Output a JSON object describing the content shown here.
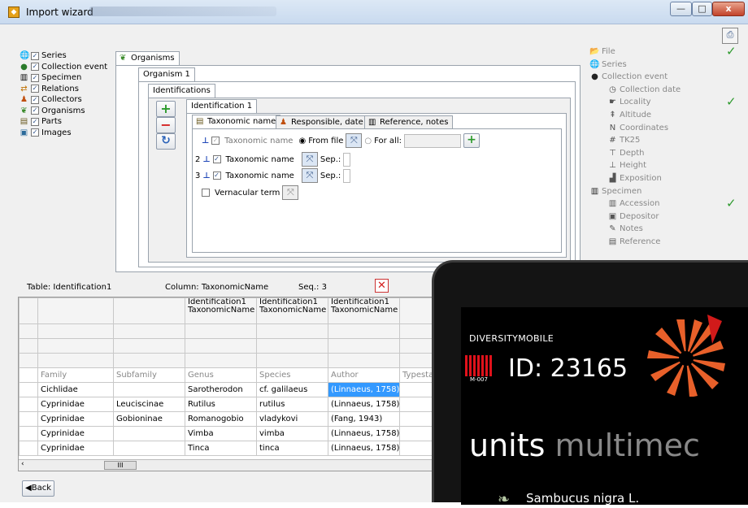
{
  "window": {
    "title": "Import wizard",
    "min": "—",
    "max": "□",
    "close": "x"
  },
  "tree": [
    {
      "label": "Series",
      "icon": "globe-icon",
      "glyph": "🌐",
      "color": "#1a5ab8"
    },
    {
      "label": "Collection event",
      "icon": "earth-icon",
      "glyph": "●",
      "color": "#2a7a2a"
    },
    {
      "label": "Specimen",
      "icon": "barcode-icon",
      "glyph": "▥",
      "color": "#000"
    },
    {
      "label": "Relations",
      "icon": "relations-icon",
      "glyph": "⇄",
      "color": "#c07000"
    },
    {
      "label": "Collectors",
      "icon": "people-icon",
      "glyph": "♟",
      "color": "#c05010"
    },
    {
      "label": "Organisms",
      "icon": "leaf-icon",
      "glyph": "❦",
      "color": "#3a8a2a"
    },
    {
      "label": "Parts",
      "icon": "parts-icon",
      "glyph": "▤",
      "color": "#6a5a20"
    },
    {
      "label": "Images",
      "icon": "image-icon",
      "glyph": "▣",
      "color": "#2a6a9a"
    }
  ],
  "tabs": {
    "organisms": "Organisms",
    "organism1": "Organism 1",
    "identifications": "Identifications",
    "identification1": "Identification 1",
    "taxonomic_name": "Taxonomic name",
    "responsible": "Responsible, date",
    "reference": "Reference, notes"
  },
  "form": {
    "row1_label": "Taxonomic name",
    "from_file": "From file",
    "for_all": "For all:",
    "row2_num": "2",
    "row2_label": "Taxonomic name",
    "sep": "Sep.:",
    "row3_num": "3",
    "row3_label": "Taxonomic name",
    "vernacular": "Vernacular term"
  },
  "status": {
    "table": "Table: Identification1",
    "column": "Column: TaxonomicName",
    "seq": "Seq.: 3"
  },
  "grid": {
    "top_headers": [
      "",
      "",
      "Identification1\nTaxonomicName",
      "Identification1\nTaxonomicName",
      "Identification1\nTaxonomicName",
      ""
    ],
    "col_headers": [
      "Family",
      "Subfamily",
      "Genus",
      "Species",
      "Author",
      "Typesta"
    ],
    "rows": [
      [
        "Cichlidae",
        "",
        "Sarotherodon",
        "cf. galilaeus",
        "(Linnaeus, 1758)",
        ""
      ],
      [
        "Cyprinidae",
        "Leuciscinae",
        "Rutilus",
        "rutilus",
        "(Linnaeus, 1758)",
        ""
      ],
      [
        "Cyprinidae",
        "Gobioninae",
        "Romanogobio",
        "vladykovi",
        "(Fang, 1943)",
        ""
      ],
      [
        "Cyprinidae",
        "",
        "Vimba",
        "vimba",
        "(Linnaeus, 1758)",
        ""
      ],
      [
        "Cyprinidae",
        "",
        "Tinca",
        "tinca",
        "(Linnaeus, 1758)",
        ""
      ]
    ],
    "scroll_thumb": "III"
  },
  "back": "◀Back",
  "right_tree": [
    {
      "label": "File",
      "glyph": "📂",
      "indent": 0,
      "check": true
    },
    {
      "label": "Series",
      "glyph": "🌐",
      "indent": 0,
      "check": false
    },
    {
      "label": "Collection event",
      "glyph": "●",
      "indent": 0,
      "check": false
    },
    {
      "label": "Collection date",
      "glyph": "◷",
      "indent": 1,
      "check": false
    },
    {
      "label": "Locality",
      "glyph": "☛",
      "indent": 1,
      "check": true
    },
    {
      "label": "Altitude",
      "glyph": "⇞",
      "indent": 1,
      "check": false
    },
    {
      "label": "Coordinates",
      "glyph": "N",
      "indent": 1,
      "check": false
    },
    {
      "label": "TK25",
      "glyph": "#",
      "indent": 1,
      "check": false
    },
    {
      "label": "Depth",
      "glyph": "⊤",
      "indent": 1,
      "check": false
    },
    {
      "label": "Height",
      "glyph": "⊥",
      "indent": 1,
      "check": false
    },
    {
      "label": "Exposition",
      "glyph": "▟",
      "indent": 1,
      "check": false
    },
    {
      "label": "Specimen",
      "glyph": "▥",
      "indent": 0,
      "check": false
    },
    {
      "label": "Accession",
      "glyph": "▥",
      "indent": 1,
      "check": true
    },
    {
      "label": "Depositor",
      "glyph": "▣",
      "indent": 1,
      "check": false
    },
    {
      "label": "Notes",
      "glyph": "✎",
      "indent": 1,
      "check": false
    },
    {
      "label": "Reference",
      "glyph": "▤",
      "indent": 1,
      "check": false
    }
  ],
  "phone": {
    "brand": "DIVERSITYMOBILE",
    "id": "ID: 23165",
    "badge": "M-007",
    "units": "units",
    "multimedia": "multimec",
    "plant": "Sambucus nigra L."
  }
}
